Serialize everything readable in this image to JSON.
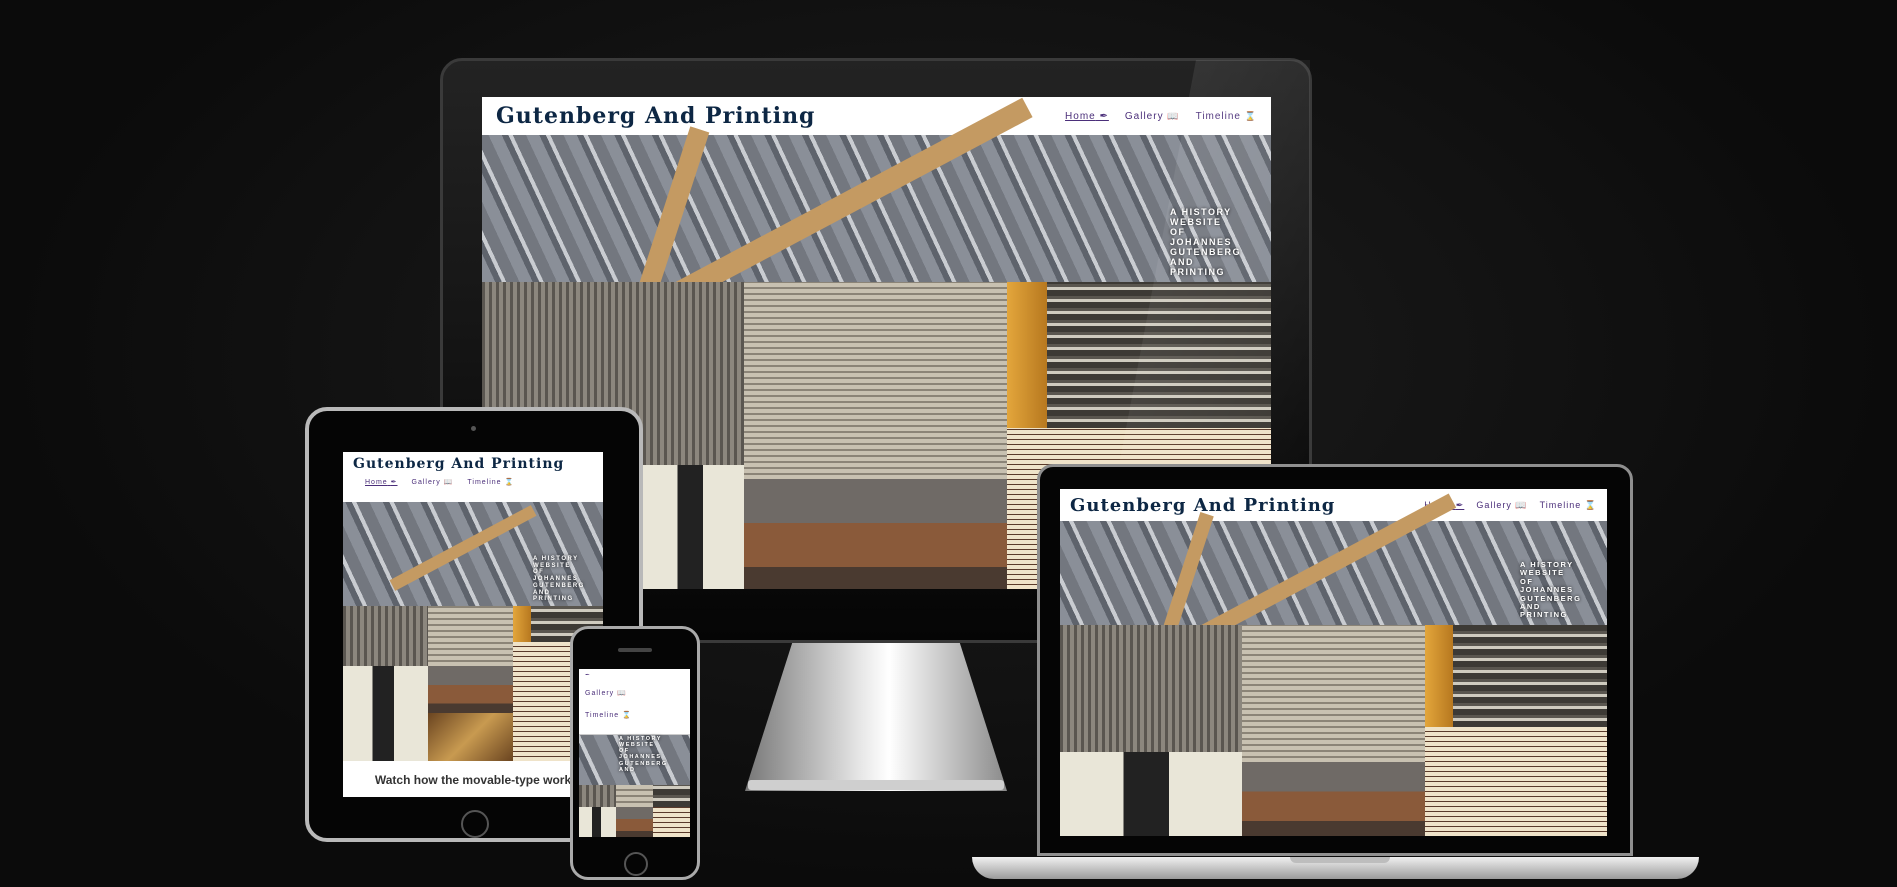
{
  "site": {
    "title": "Gutenberg And Printing",
    "nav": {
      "home": "Home",
      "gallery": "Gallery",
      "timeline": "Timeline",
      "home_icon": "quill-icon",
      "gallery_icon": "book-icon",
      "timeline_icon": "hourglass-icon"
    },
    "hero_lines": [
      "A HISTORY",
      "WEBSITE",
      "OF",
      "JOHANNES",
      "GUTENBERG",
      "AND",
      "PRINTING"
    ],
    "tablet_caption": "Watch how the movable-type work"
  },
  "icons": {
    "quill": "✒",
    "book": "📖",
    "hourglass": "⌛"
  },
  "colors": {
    "background": "#0b0b0b",
    "logo": "#0d2744",
    "nav_link": "#4b2f7a"
  }
}
